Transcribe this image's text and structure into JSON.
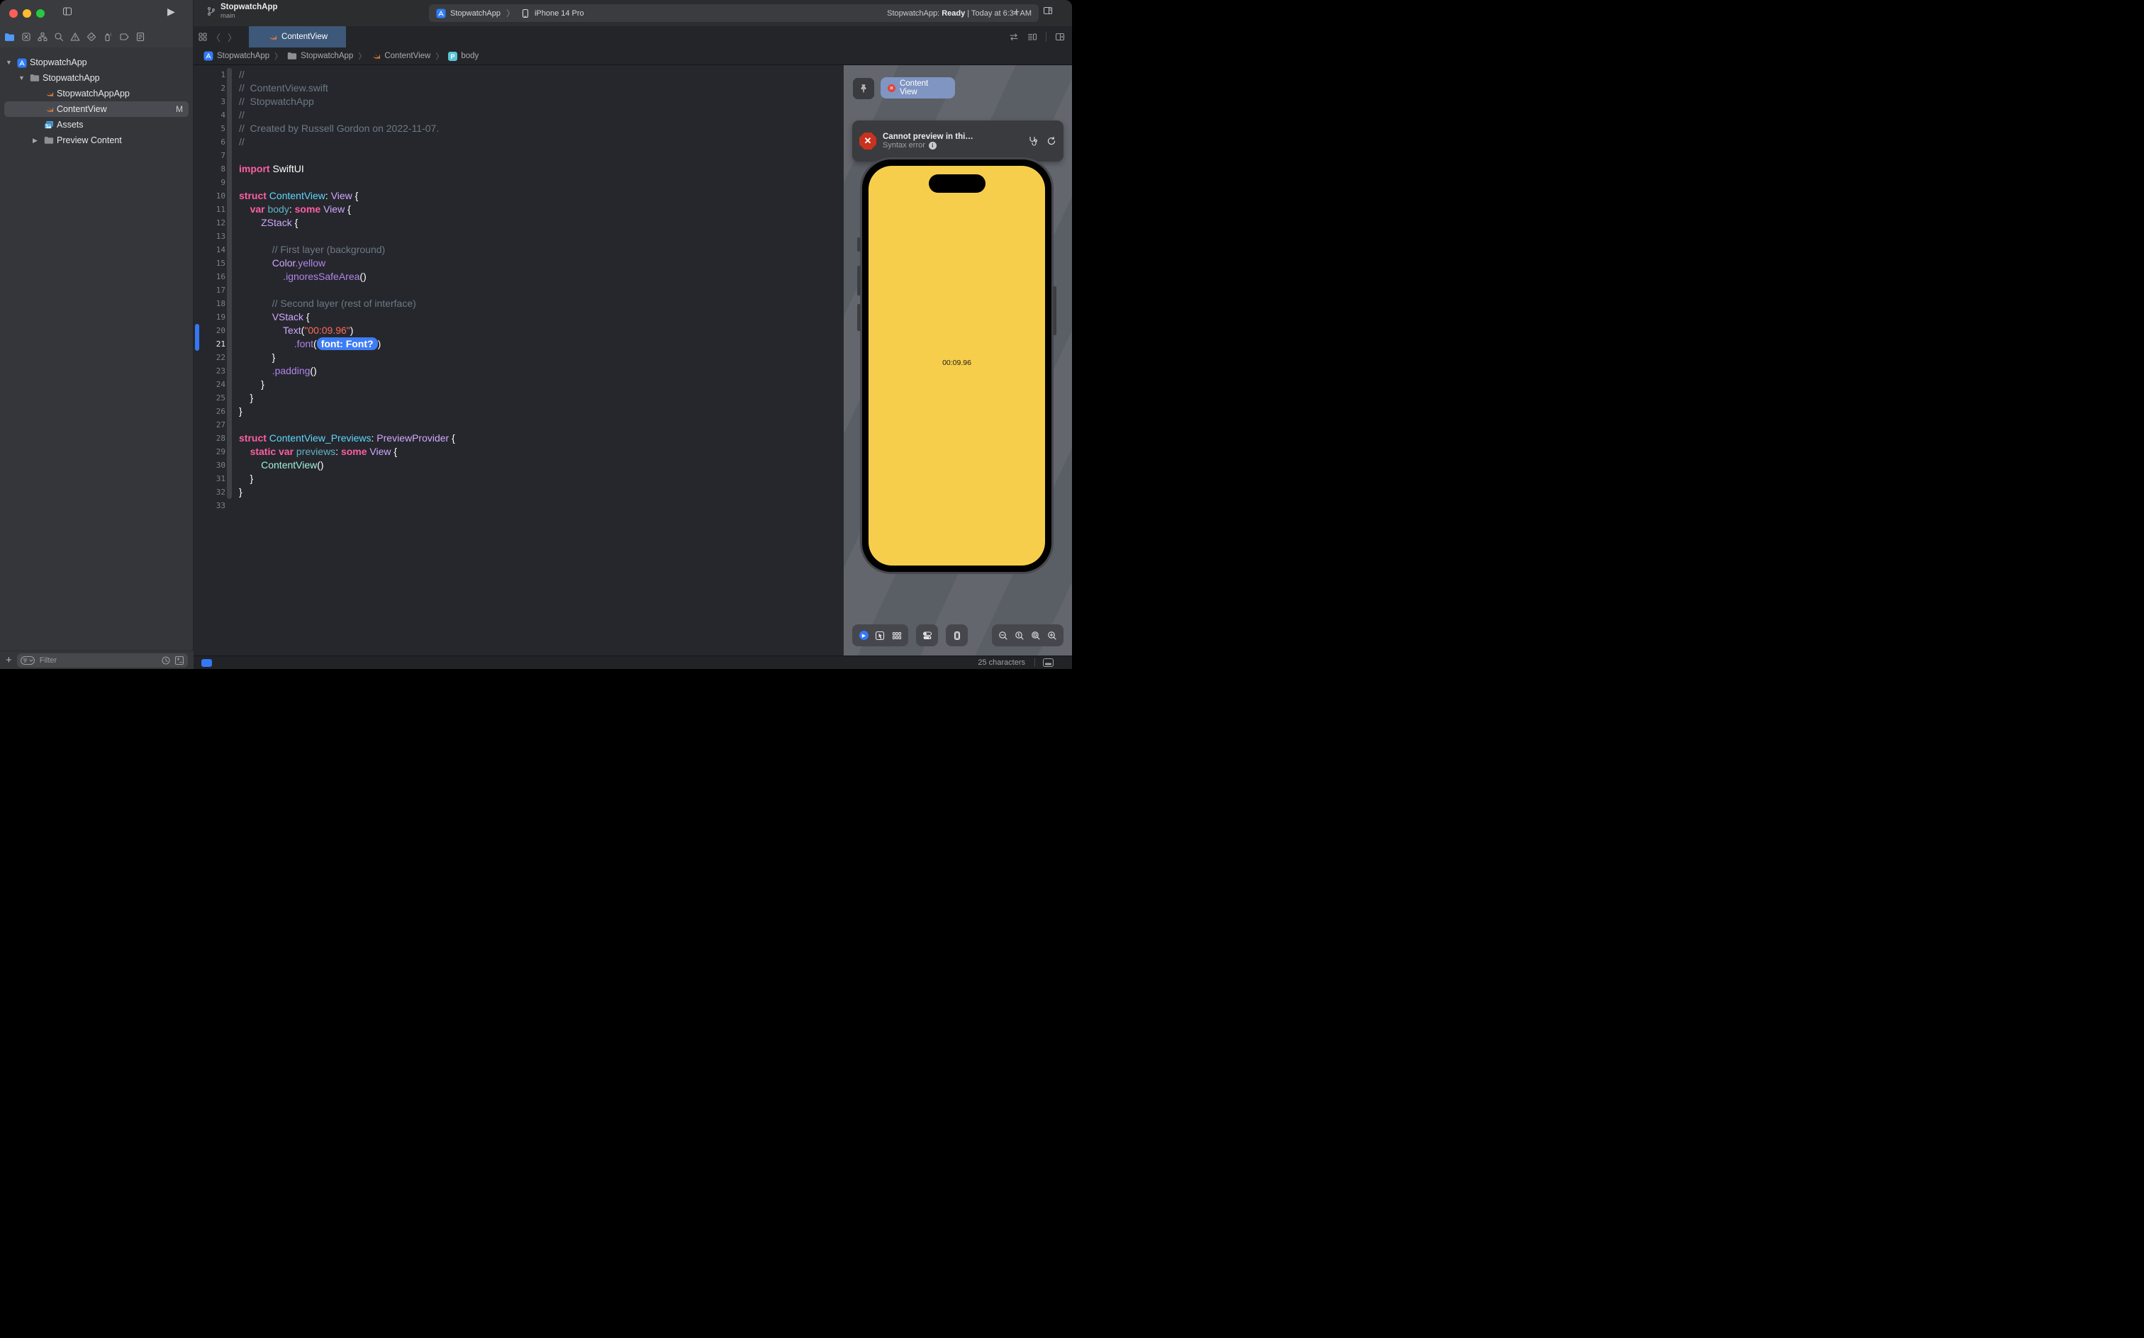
{
  "toolbar": {
    "project": "StopwatchApp",
    "branch": "main",
    "add_label": "+",
    "scheme": {
      "app": "StopwatchApp",
      "device": "iPhone 14 Pro",
      "status_prefix": "StopwatchApp:",
      "status_bold": "Ready",
      "status_suffix": "| Today at 6:34 AM"
    }
  },
  "navigator": {
    "items": [
      {
        "name": "project-navigator",
        "icon": "folder",
        "selected": true
      },
      {
        "name": "source-control-navigator",
        "icon": "xsquare",
        "selected": false
      },
      {
        "name": "symbol-navigator",
        "icon": "symbol",
        "selected": false
      },
      {
        "name": "find-navigator",
        "icon": "find",
        "selected": false
      },
      {
        "name": "issue-navigator",
        "icon": "issue",
        "selected": false
      },
      {
        "name": "test-navigator",
        "icon": "test",
        "selected": false
      },
      {
        "name": "debug-navigator",
        "icon": "spray",
        "selected": false
      },
      {
        "name": "breakpoint-navigator",
        "icon": "tag",
        "selected": false
      },
      {
        "name": "report-navigator",
        "icon": "report",
        "selected": false
      }
    ],
    "filter_placeholder": "Filter"
  },
  "tree": [
    {
      "label": "StopwatchApp",
      "icon": "appicon",
      "disc": "open",
      "level": 0,
      "selected": false,
      "badge": ""
    },
    {
      "label": "StopwatchApp",
      "icon": "folderbig",
      "disc": "open",
      "level": 1,
      "selected": false,
      "badge": ""
    },
    {
      "label": "StopwatchAppApp",
      "icon": "swift",
      "disc": "",
      "level": 2,
      "selected": false,
      "badge": ""
    },
    {
      "label": "ContentView",
      "icon": "swift",
      "disc": "",
      "level": 2,
      "selected": true,
      "badge": "M"
    },
    {
      "label": "Assets",
      "icon": "assets",
      "disc": "",
      "level": 2,
      "selected": false,
      "badge": ""
    },
    {
      "label": "Preview Content",
      "icon": "folderbig",
      "disc": "closed",
      "level": 2,
      "selected": false,
      "badge": ""
    }
  ],
  "tab": {
    "label": "ContentView"
  },
  "breadcrumb": [
    {
      "icon": "appicon",
      "label": "StopwatchApp"
    },
    {
      "icon": "folderbig",
      "label": "StopwatchApp"
    },
    {
      "icon": "swift",
      "label": "ContentView"
    },
    {
      "icon": "pbadge",
      "label": "body"
    }
  ],
  "editor": {
    "current_line": 21,
    "lines": [
      {
        "n": 1,
        "s": [
          [
            "cmt",
            "//"
          ]
        ]
      },
      {
        "n": 2,
        "s": [
          [
            "cmt",
            "//  ContentView.swift"
          ]
        ]
      },
      {
        "n": 3,
        "s": [
          [
            "cmt",
            "//  StopwatchApp"
          ]
        ]
      },
      {
        "n": 4,
        "s": [
          [
            "cmt",
            "//"
          ]
        ]
      },
      {
        "n": 5,
        "s": [
          [
            "cmt",
            "//  Created by Russell Gordon on 2022-11-07."
          ]
        ]
      },
      {
        "n": 6,
        "s": [
          [
            "cmt",
            "//"
          ]
        ]
      },
      {
        "n": 7,
        "s": []
      },
      {
        "n": 8,
        "s": [
          [
            "kw",
            "import"
          ],
          [
            "pl",
            " SwiftUI"
          ]
        ]
      },
      {
        "n": 9,
        "s": []
      },
      {
        "n": 10,
        "s": [
          [
            "kw",
            "struct"
          ],
          [
            "decl",
            " ContentView"
          ],
          [
            "pl",
            ": "
          ],
          [
            "type",
            "View"
          ],
          [
            "pl",
            " {"
          ]
        ]
      },
      {
        "n": 11,
        "s": [
          [
            "pl",
            "    "
          ],
          [
            "kw",
            "var"
          ],
          [
            "prop",
            " body"
          ],
          [
            "pl",
            ": "
          ],
          [
            "kw",
            "some"
          ],
          [
            "type",
            " View"
          ],
          [
            "pl",
            " {"
          ]
        ]
      },
      {
        "n": 12,
        "s": [
          [
            "pl",
            "        "
          ],
          [
            "type",
            "ZStack"
          ],
          [
            "pl",
            " {"
          ]
        ]
      },
      {
        "n": 13,
        "s": []
      },
      {
        "n": 14,
        "s": [
          [
            "cmt",
            "            // First layer (background)"
          ]
        ]
      },
      {
        "n": 15,
        "s": [
          [
            "pl",
            "            "
          ],
          [
            "type",
            "Color"
          ],
          [
            "mem",
            ".yellow"
          ]
        ]
      },
      {
        "n": 16,
        "s": [
          [
            "pl",
            "                "
          ],
          [
            "mem",
            ".ignoresSafeArea"
          ],
          [
            "pl",
            "()"
          ]
        ]
      },
      {
        "n": 17,
        "s": []
      },
      {
        "n": 18,
        "s": [
          [
            "cmt",
            "            // Second layer (rest of interface)"
          ]
        ]
      },
      {
        "n": 19,
        "s": [
          [
            "pl",
            "            "
          ],
          [
            "type",
            "VStack"
          ],
          [
            "pl",
            " {"
          ]
        ]
      },
      {
        "n": 20,
        "s": [
          [
            "pl",
            "                "
          ],
          [
            "type",
            "Text"
          ],
          [
            "pl",
            "("
          ],
          [
            "str",
            "\"00:09.96\""
          ],
          [
            "pl",
            ")"
          ]
        ]
      },
      {
        "n": 21,
        "s": [
          [
            "pl",
            "                    "
          ],
          [
            "mem",
            ".font"
          ],
          [
            "pl",
            "("
          ],
          [
            "ph",
            "font: Font?"
          ],
          [
            "pl",
            ")"
          ]
        ]
      },
      {
        "n": 22,
        "s": [
          [
            "pl",
            "            }"
          ]
        ]
      },
      {
        "n": 23,
        "s": [
          [
            "pl",
            "            "
          ],
          [
            "mem",
            ".padding"
          ],
          [
            "pl",
            "()"
          ]
        ]
      },
      {
        "n": 24,
        "s": [
          [
            "pl",
            "        }"
          ]
        ]
      },
      {
        "n": 25,
        "s": [
          [
            "pl",
            "    }"
          ]
        ]
      },
      {
        "n": 26,
        "s": [
          [
            "pl",
            "}"
          ]
        ]
      },
      {
        "n": 27,
        "s": []
      },
      {
        "n": 28,
        "s": [
          [
            "kw",
            "struct"
          ],
          [
            "decl",
            " ContentView_Previews"
          ],
          [
            "pl",
            ": "
          ],
          [
            "type",
            "PreviewProvider"
          ],
          [
            "pl",
            " {"
          ]
        ]
      },
      {
        "n": 29,
        "s": [
          [
            "pl",
            "    "
          ],
          [
            "kw",
            "static var"
          ],
          [
            "prop",
            " previews"
          ],
          [
            "pl",
            ": "
          ],
          [
            "kw",
            "some"
          ],
          [
            "type",
            " View"
          ],
          [
            "pl",
            " {"
          ]
        ]
      },
      {
        "n": 30,
        "s": [
          [
            "pl",
            "        "
          ],
          [
            "mint",
            "ContentView"
          ],
          [
            "pl",
            "()"
          ]
        ]
      },
      {
        "n": 31,
        "s": [
          [
            "pl",
            "    }"
          ]
        ]
      },
      {
        "n": 32,
        "s": [
          [
            "pl",
            "}"
          ]
        ]
      },
      {
        "n": 33,
        "s": []
      }
    ]
  },
  "preview": {
    "tab_label": "Content View",
    "error_title": "Cannot preview in thi…",
    "error_subtitle": "Syntax error",
    "time": "00:09.96",
    "colors": {
      "screen_yellow": "#f6ce4b",
      "error_red": "#c8321f",
      "accent_blue": "#3478f6"
    }
  },
  "statusbar": {
    "chars": "25 characters"
  }
}
